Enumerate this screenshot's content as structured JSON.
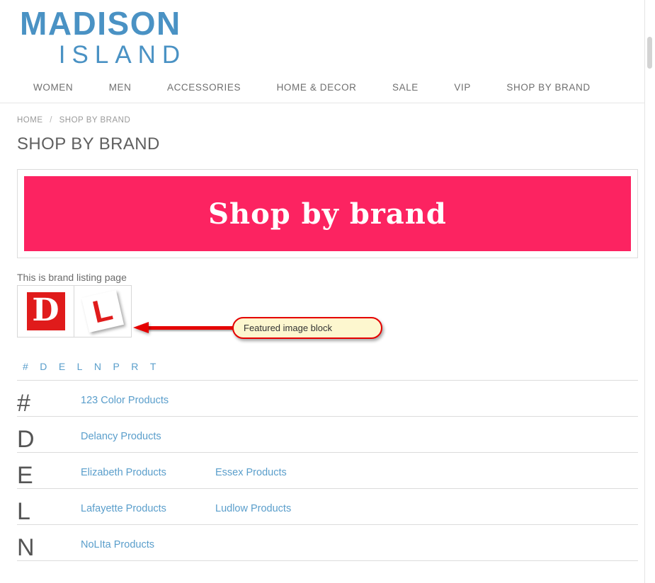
{
  "header": {
    "logo_main": "MADISON",
    "logo_sub": "ISLAND"
  },
  "nav": {
    "items": [
      {
        "label": "WOMEN"
      },
      {
        "label": "MEN"
      },
      {
        "label": "ACCESSORIES"
      },
      {
        "label": "HOME & DECOR"
      },
      {
        "label": "SALE"
      },
      {
        "label": "VIP"
      },
      {
        "label": "SHOP BY BRAND"
      }
    ]
  },
  "breadcrumb": {
    "home": "HOME",
    "separator": "/",
    "current": "SHOP BY BRAND"
  },
  "page_title": "SHOP BY BRAND",
  "banner": {
    "text": "Shop by brand",
    "background_color": "#fc2361",
    "text_color": "#ffffff"
  },
  "featured": {
    "caption": "This is brand listing page",
    "thumbnails": [
      {
        "letter": "D",
        "style": "red-box"
      },
      {
        "letter": "L",
        "style": "tilted-card"
      }
    ]
  },
  "callout": {
    "text": "Featured image block",
    "border_color": "#e50000",
    "fill_color": "#fdf7cf"
  },
  "alpha_index": {
    "letters": [
      "#",
      "D",
      "E",
      "L",
      "N",
      "P",
      "R",
      "T"
    ]
  },
  "brands": {
    "rows": [
      {
        "letter": "#",
        "links": [
          "123 Color Products"
        ]
      },
      {
        "letter": "D",
        "links": [
          "Delancy Products"
        ]
      },
      {
        "letter": "E",
        "links": [
          "Elizabeth Products",
          "Essex Products"
        ]
      },
      {
        "letter": "L",
        "links": [
          "Lafayette Products",
          "Ludlow Products"
        ]
      },
      {
        "letter": "N",
        "links": [
          "NoLIta Products"
        ]
      }
    ]
  },
  "colors": {
    "brand_blue": "#4a92c4",
    "link_blue": "#5a9ecb",
    "banner_pink": "#fc2361",
    "callout_red": "#e50000"
  }
}
